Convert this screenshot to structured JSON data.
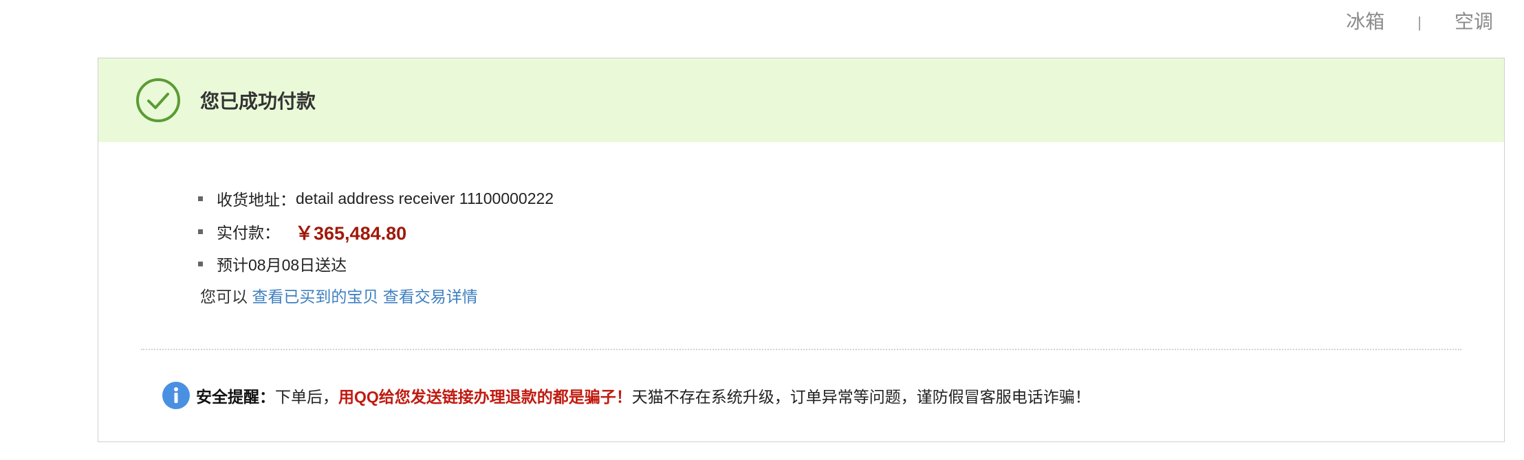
{
  "topnav": {
    "link1": "冰箱",
    "separator": "|",
    "link2": "空调"
  },
  "panel": {
    "title": "您已成功付款",
    "success_color": "#5a9c35"
  },
  "details": {
    "address_label": "收货地址：",
    "address_value": "detail address receiver 11100000222",
    "paid_label": "实付款：",
    "paid_value": "￥365,484.80",
    "delivery": "预计08月08日送达"
  },
  "links": {
    "prefix": "您可以",
    "view_bought": "查看已买到的宝贝",
    "view_details": "查看交易详情"
  },
  "warning": {
    "label": "安全提醒：",
    "text1": "下单后，",
    "red_text": "用QQ给您发送链接办理退款的都是骗子！",
    "text2": "天猫不存在系统升级，订单异常等问题，谨防假冒客服电话诈骗！"
  },
  "colors": {
    "header_bg": "#eafad9",
    "price": "#a0190a",
    "link": "#3e7fc1",
    "info": "#4a90e2"
  },
  "icons": {
    "check": "check-circle-icon",
    "info": "info-icon"
  }
}
